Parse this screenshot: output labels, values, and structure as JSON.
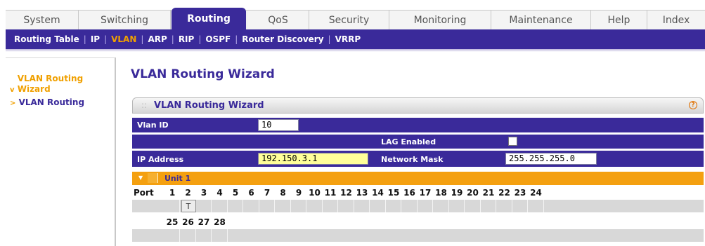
{
  "top_tabs": [
    {
      "label": "System"
    },
    {
      "label": "Switching"
    },
    {
      "label": "Routing",
      "active": true
    },
    {
      "label": "QoS"
    },
    {
      "label": "Security"
    },
    {
      "label": "Monitoring"
    },
    {
      "label": "Maintenance"
    },
    {
      "label": "Help"
    },
    {
      "label": "Index"
    }
  ],
  "subnav": [
    {
      "label": "Routing Table"
    },
    {
      "label": "IP"
    },
    {
      "label": "VLAN",
      "active": true
    },
    {
      "label": "ARP"
    },
    {
      "label": "RIP"
    },
    {
      "label": "OSPF"
    },
    {
      "label": "Router Discovery"
    },
    {
      "label": "VRRP"
    }
  ],
  "left_nav": {
    "items": [
      {
        "bullet": "v",
        "label": "VLAN Routing Wizard",
        "active": true
      },
      {
        "bullet": ">",
        "label": "VLAN Routing"
      }
    ]
  },
  "page_title": "VLAN Routing Wizard",
  "panel": {
    "title": "VLAN Routing Wizard",
    "help_symbol": "?",
    "vlan_id_label": "Vlan ID",
    "vlan_id_value": "10",
    "lag_enabled_label": "LAG Enabled",
    "lag_enabled_checked": false,
    "ip_address_label": "IP Address",
    "ip_address_value": "192.150.3.1",
    "network_mask_label": "Network Mask",
    "network_mask_value": "255.255.255.0",
    "unit_label": "Unit 1",
    "port_label": "Port",
    "ports_row1": [
      "1",
      "2",
      "3",
      "4",
      "5",
      "6",
      "7",
      "8",
      "9",
      "10",
      "11",
      "12",
      "13",
      "14",
      "15",
      "16",
      "17",
      "18",
      "19",
      "20",
      "21",
      "22",
      "23",
      "24"
    ],
    "ports_row2": [
      "25",
      "26",
      "27",
      "28"
    ],
    "tagged_port": "2",
    "tagged_marker": "T"
  },
  "colors": {
    "brand_purple": "#3a2a9a",
    "accent_orange": "#f4a010",
    "ip_field_bg": "#ffff99"
  }
}
